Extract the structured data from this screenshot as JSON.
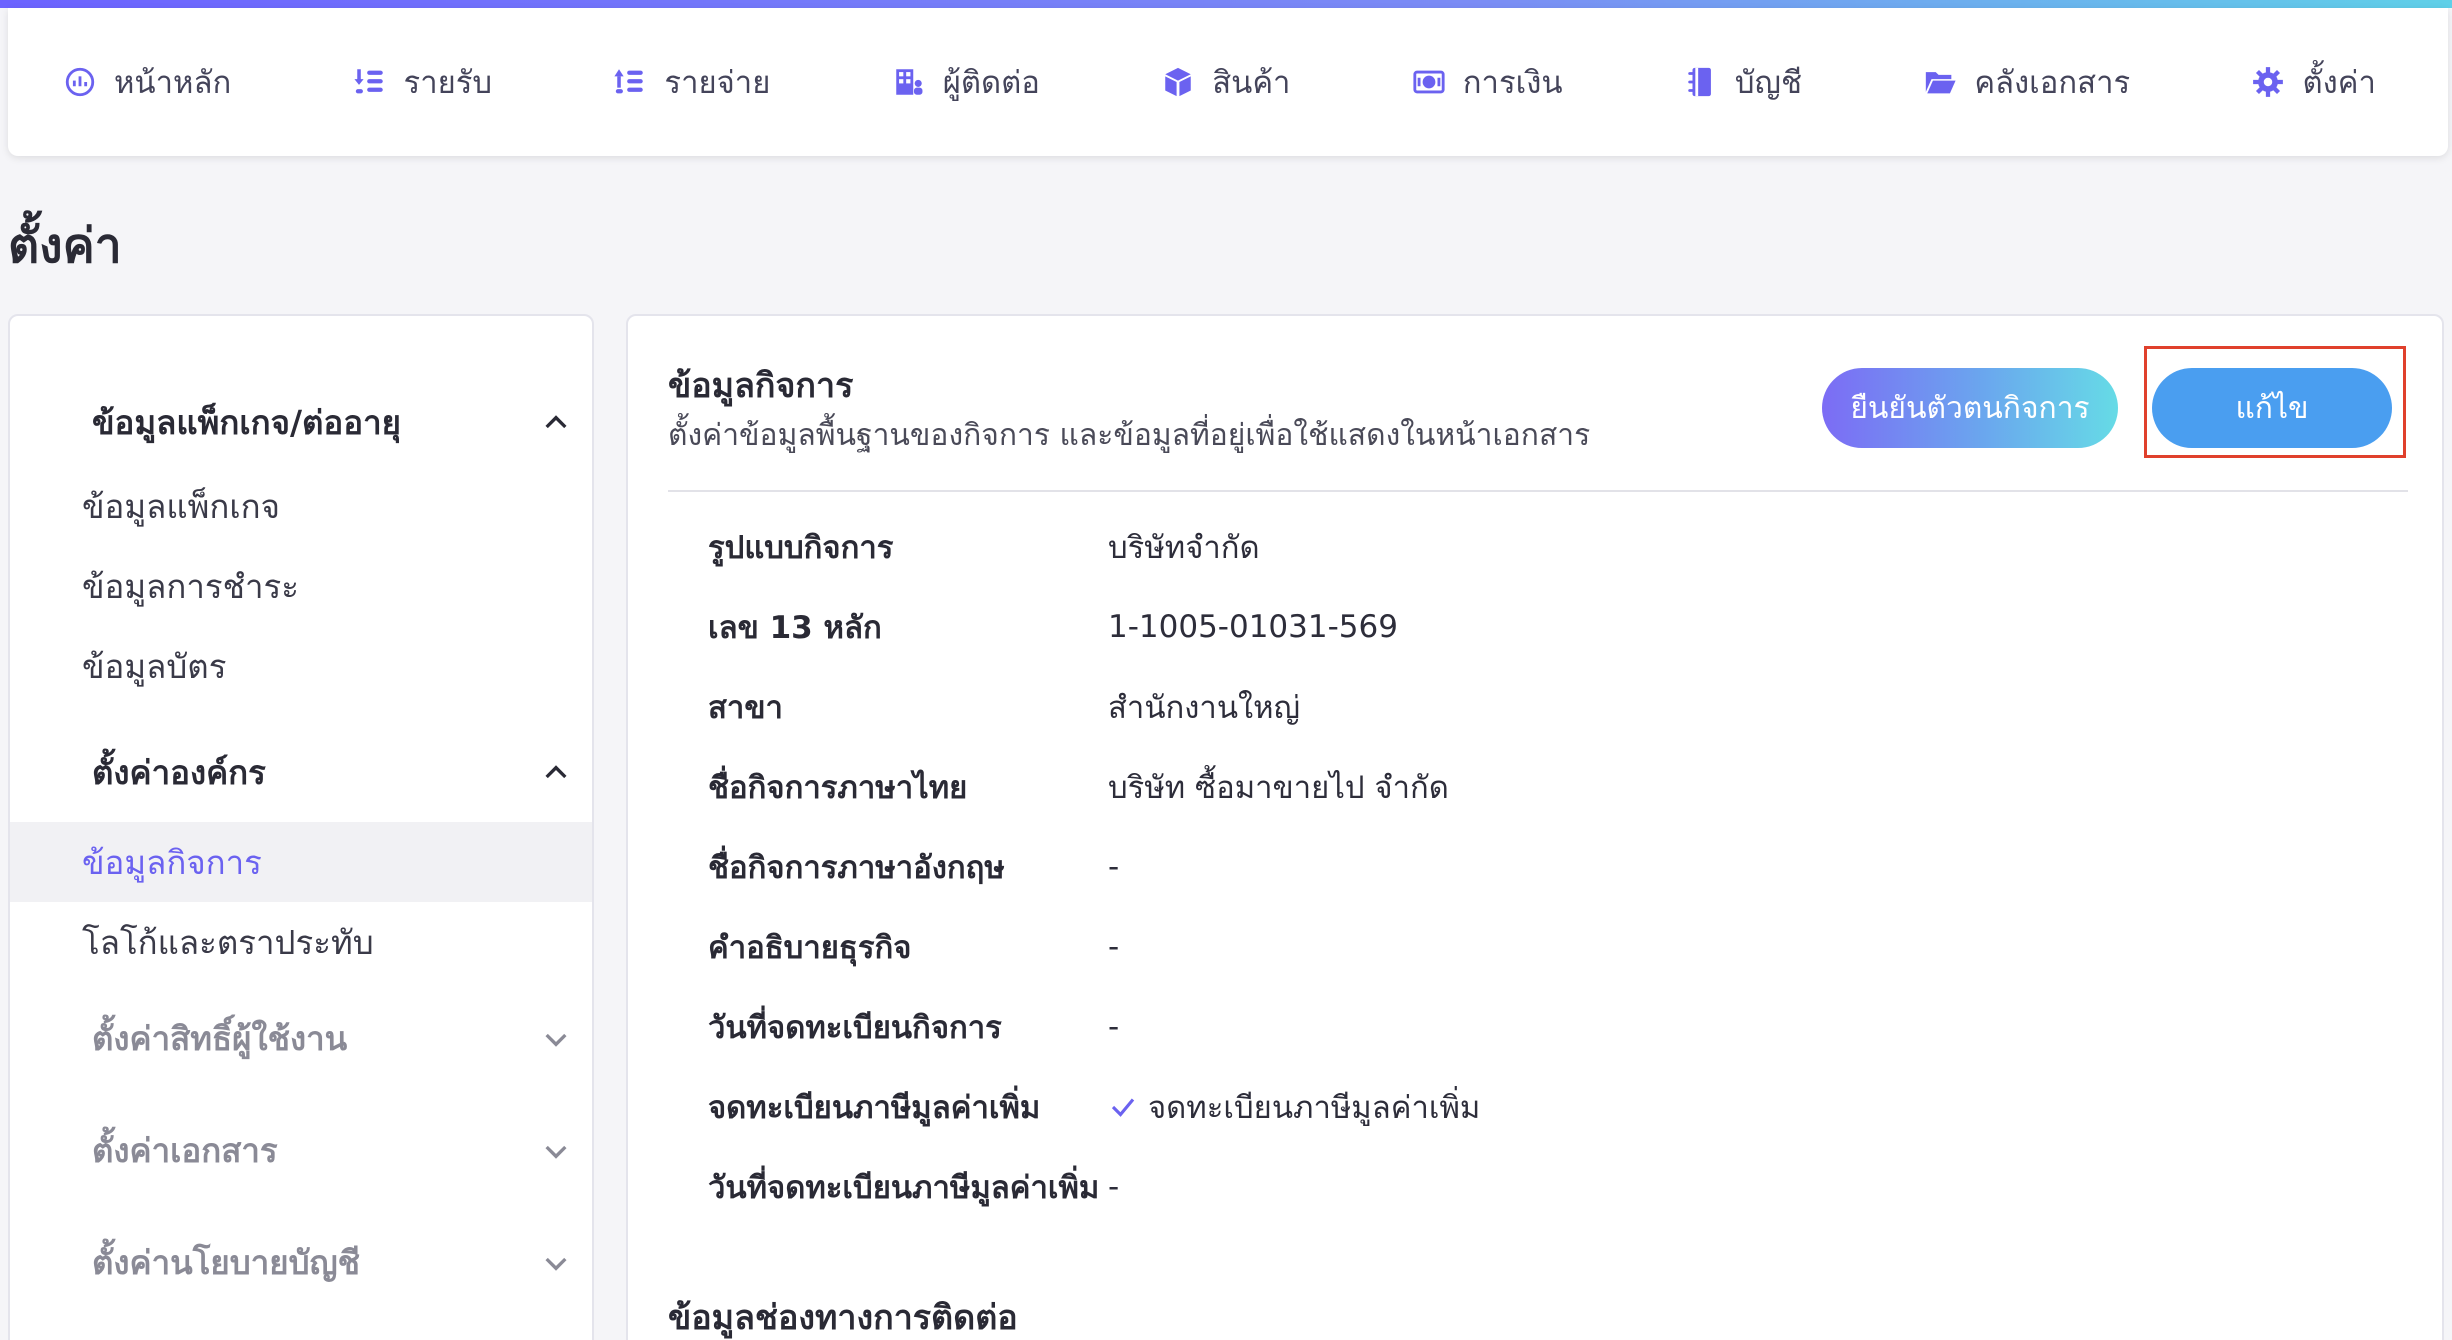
{
  "nav": {
    "items": [
      {
        "label": "หน้าหลัก",
        "icon": "dashboard-icon"
      },
      {
        "label": "รายรับ",
        "icon": "income-icon"
      },
      {
        "label": "รายจ่าย",
        "icon": "expense-icon"
      },
      {
        "label": "ผู้ติดต่อ",
        "icon": "contacts-icon"
      },
      {
        "label": "สินค้า",
        "icon": "product-box-icon"
      },
      {
        "label": "การเงิน",
        "icon": "money-icon"
      },
      {
        "label": "บัญชี",
        "icon": "ledger-book-icon"
      },
      {
        "label": "คลังเอกสาร",
        "icon": "folder-icon"
      },
      {
        "label": "ตั้งค่า",
        "icon": "gear-icon"
      }
    ]
  },
  "page": {
    "title": "ตั้งค่า"
  },
  "sidebar": {
    "group_package": "ข้อมูลแพ็กเกจ/ต่ออายุ",
    "package_items": [
      "ข้อมูลแพ็กเกจ",
      "ข้อมูลการชำระ",
      "ข้อมูลบัตร"
    ],
    "group_org": "ตั้งค่าองค์กร",
    "org_items": [
      "ข้อมูลกิจการ",
      "โลโก้และตราประทับ"
    ],
    "group_permissions": "ตั้งค่าสิทธิ์ผู้ใช้งาน",
    "group_documents": "ตั้งค่าเอกสาร",
    "group_policy": "ตั้งค่านโยบายบัญชี"
  },
  "main": {
    "section_title": "ข้อมูลกิจการ",
    "section_desc": "ตั้งค่าข้อมูลพื้นฐานของกิจการ และข้อมูลที่อยู่เพื่อใช้แสดงในหน้าเอกสาร",
    "verify_button": "ยืนยันตัวตนกิจการ",
    "edit_button": "แก้ไข",
    "rows": [
      {
        "label": "รูปแบบกิจการ",
        "value": "บริษัทจำกัด"
      },
      {
        "label": "เลข 13 หลัก",
        "value": "1-1005-01031-569"
      },
      {
        "label": "สาขา",
        "value": "สำนักงานใหญ่"
      },
      {
        "label": "ชื่อกิจการภาษาไทย",
        "value": "บริษัท ซื้อมาขายไป จำกัด"
      },
      {
        "label": "ชื่อกิจการภาษาอังกฤษ",
        "value": "-"
      },
      {
        "label": "คำอธิบายธุรกิจ",
        "value": "-"
      },
      {
        "label": "วันที่จดทะเบียนกิจการ",
        "value": "-"
      },
      {
        "label": "จดทะเบียนภาษีมูลค่าเพิ่ม",
        "value": "จดทะเบียนภาษีมูลค่าเพิ่ม"
      },
      {
        "label": "วันที่จดทะเบียนภาษีมูลค่าเพิ่ม",
        "value": "-"
      }
    ],
    "contact_section_title": "ข้อมูลช่องทางการติดต่อ"
  },
  "colors": {
    "accent": "#6b62f0",
    "edit_button": "#4a9ef0",
    "highlight_frame": "#e0402c",
    "check": "#6b62f0"
  }
}
